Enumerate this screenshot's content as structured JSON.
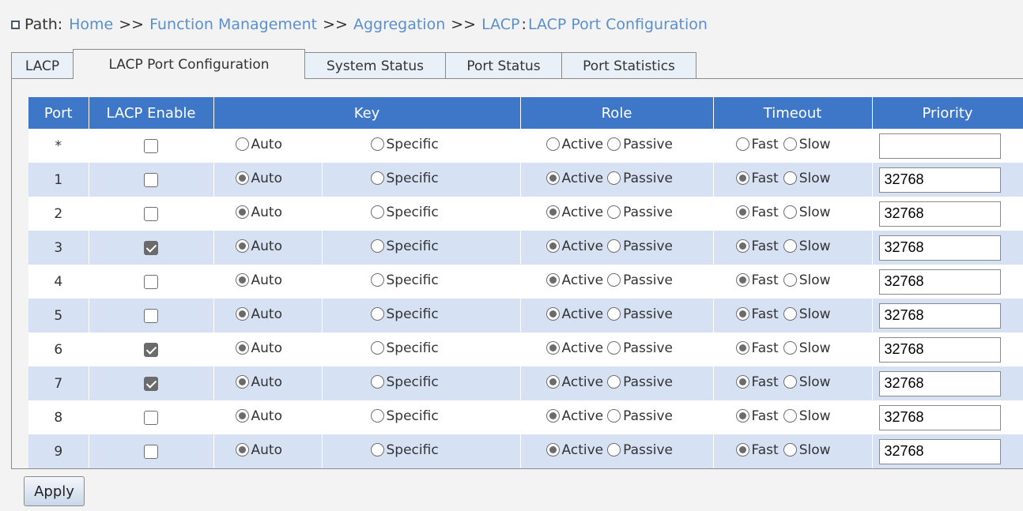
{
  "path": {
    "label": "Path:",
    "crumbs": [
      "Home",
      "Function Management",
      "Aggregation",
      "LACP"
    ],
    "separator": ">>",
    "colon": ":",
    "current": "LACP Port Configuration"
  },
  "tabs": [
    {
      "label": "LACP",
      "active": false
    },
    {
      "label": "LACP Port Configuration",
      "active": true
    },
    {
      "label": "System Status",
      "active": false
    },
    {
      "label": "Port Status",
      "active": false
    },
    {
      "label": "Port Statistics",
      "active": false
    }
  ],
  "columns": {
    "port": "Port",
    "lacp_enable": "LACP Enable",
    "key": "Key",
    "role": "Role",
    "timeout": "Timeout",
    "priority": "Priority"
  },
  "options": {
    "auto": "Auto",
    "specific": "Specific",
    "active": "Active",
    "passive": "Passive",
    "fast": "Fast",
    "slow": "Slow"
  },
  "rows": [
    {
      "port": "*",
      "enabled": false,
      "key": "",
      "role": "",
      "timeout": "",
      "priority": ""
    },
    {
      "port": "1",
      "enabled": false,
      "key": "auto",
      "role": "active",
      "timeout": "fast",
      "priority": "32768"
    },
    {
      "port": "2",
      "enabled": false,
      "key": "auto",
      "role": "active",
      "timeout": "fast",
      "priority": "32768"
    },
    {
      "port": "3",
      "enabled": true,
      "key": "auto",
      "role": "active",
      "timeout": "fast",
      "priority": "32768"
    },
    {
      "port": "4",
      "enabled": false,
      "key": "auto",
      "role": "active",
      "timeout": "fast",
      "priority": "32768"
    },
    {
      "port": "5",
      "enabled": false,
      "key": "auto",
      "role": "active",
      "timeout": "fast",
      "priority": "32768"
    },
    {
      "port": "6",
      "enabled": true,
      "key": "auto",
      "role": "active",
      "timeout": "fast",
      "priority": "32768"
    },
    {
      "port": "7",
      "enabled": true,
      "key": "auto",
      "role": "active",
      "timeout": "fast",
      "priority": "32768"
    },
    {
      "port": "8",
      "enabled": false,
      "key": "auto",
      "role": "active",
      "timeout": "fast",
      "priority": "32768"
    },
    {
      "port": "9",
      "enabled": false,
      "key": "auto",
      "role": "active",
      "timeout": "fast",
      "priority": "32768"
    }
  ],
  "apply_label": "Apply",
  "colors": {
    "header_bg": "#3e77c8",
    "row_alt_bg": "#d6e2f4",
    "link": "#5a8fd0"
  }
}
